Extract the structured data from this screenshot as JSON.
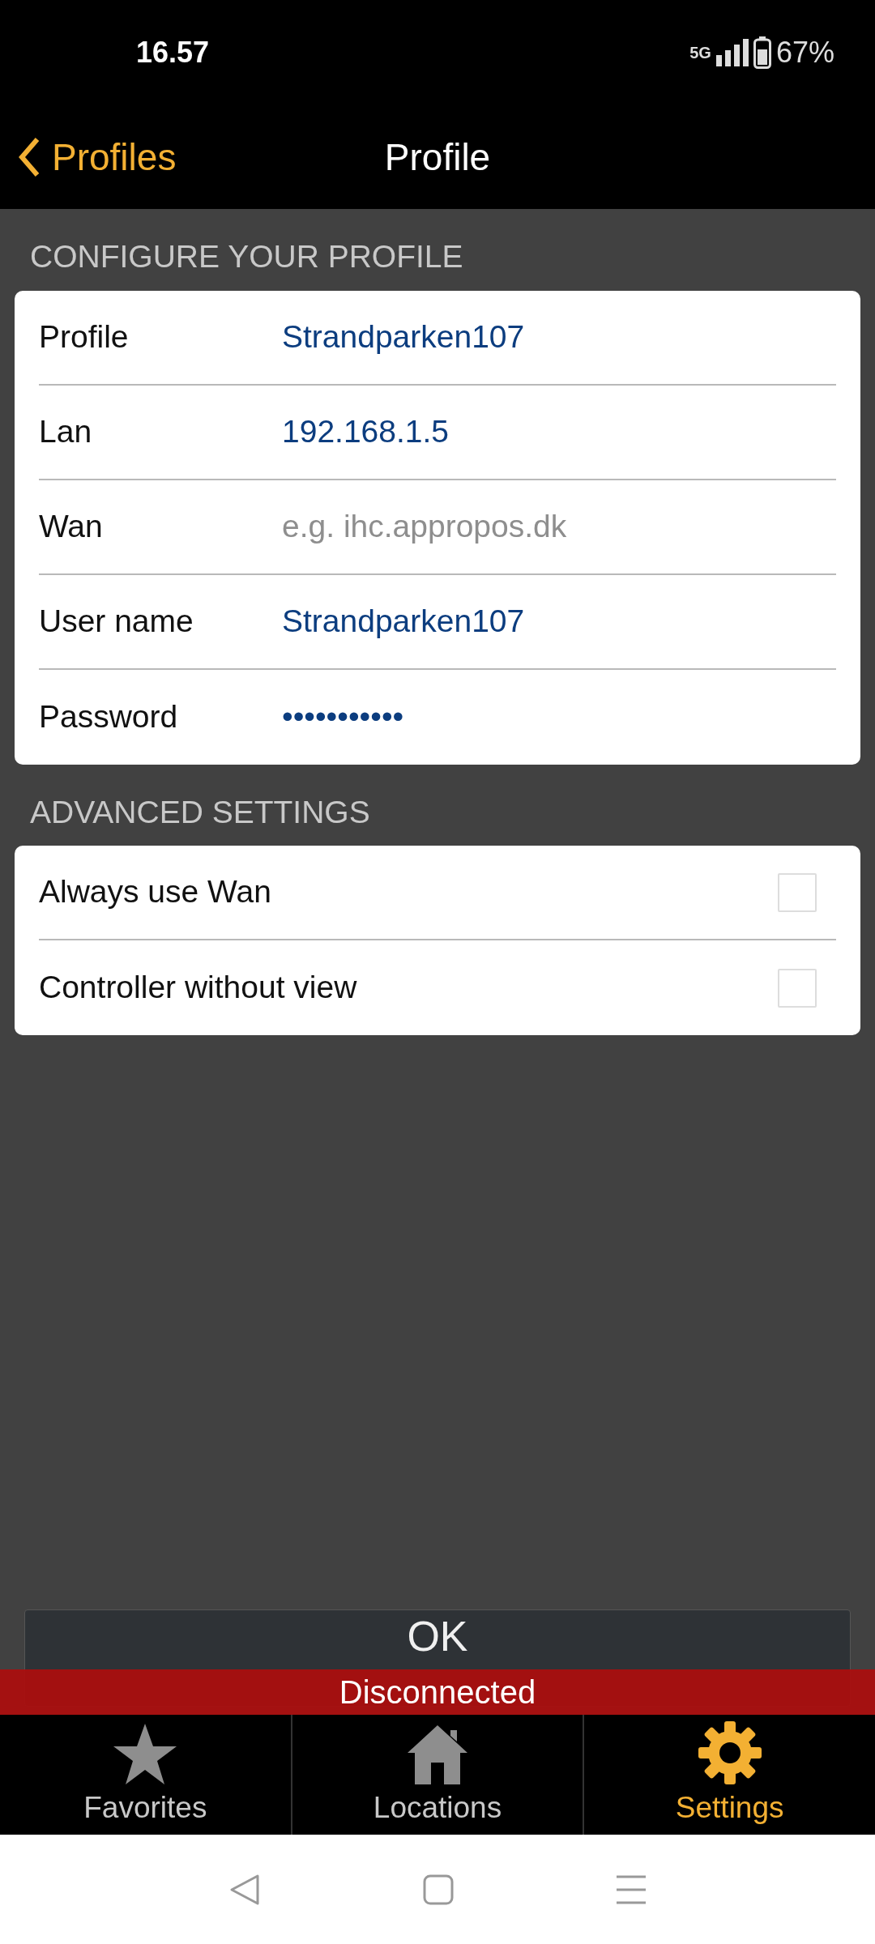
{
  "status_bar": {
    "time": "16.57",
    "network": "5G",
    "battery": "67%"
  },
  "nav": {
    "back": "Profiles",
    "title": "Profile"
  },
  "sections": [
    {
      "header": "CONFIGURE YOUR PROFILE",
      "rows": [
        {
          "kind": "field",
          "label": "Profile",
          "value": "Strandparken107"
        },
        {
          "kind": "field",
          "label": "Lan",
          "value": "192.168.1.5"
        },
        {
          "kind": "field",
          "label": "Wan",
          "placeholder": "e.g. ihc.appropos.dk"
        },
        {
          "kind": "field",
          "label": "User name",
          "value": "Strandparken107"
        },
        {
          "kind": "field",
          "label": "Password",
          "value": "•••••••••••"
        }
      ]
    },
    {
      "header": "ADVANCED SETTINGS",
      "rows": [
        {
          "kind": "checkbox",
          "label": "Always use Wan",
          "checked": false
        },
        {
          "kind": "checkbox",
          "label": "Controller without view",
          "checked": false
        }
      ]
    }
  ],
  "ok_button": "OK",
  "banner": "Disconnected",
  "tabs": [
    {
      "label": "Favorites",
      "selected": false
    },
    {
      "label": "Locations",
      "selected": false
    },
    {
      "label": "Settings",
      "selected": true
    }
  ]
}
